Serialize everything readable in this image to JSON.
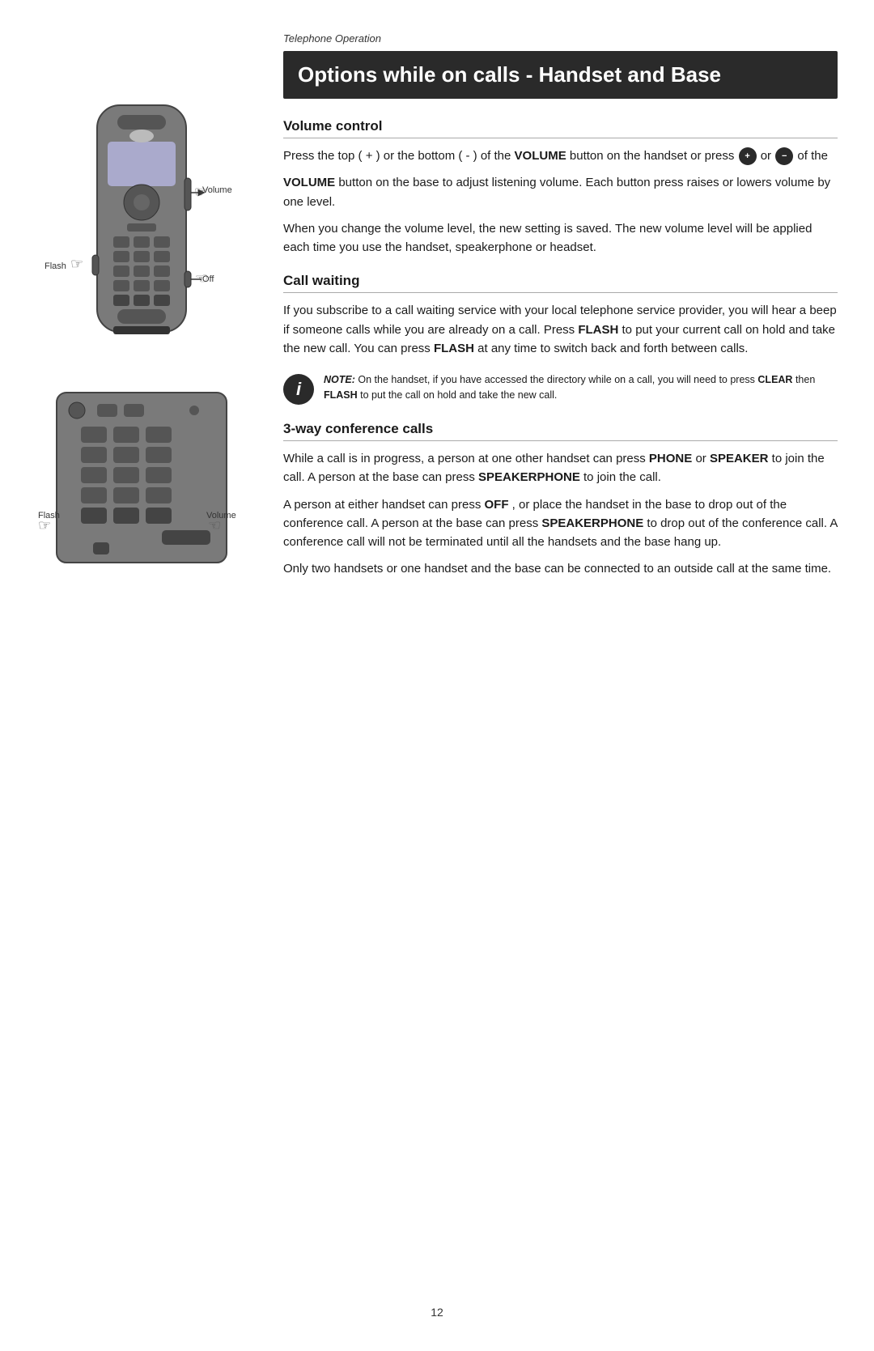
{
  "breadcrumb": "Telephone Operation",
  "page_title": "Options while on calls - Handset and Base",
  "page_number": "12",
  "sections": {
    "volume_control": {
      "title": "Volume control",
      "para1_start": "Press the top ( + ) or the bottom ( - ) of the ",
      "para1_bold1": "VOLUME",
      "para1_mid": " button on the handset or press",
      "para1_or": "or",
      "para1_end": " of the",
      "para2_bold": "VOLUME",
      "para2_end": " button on the base to adjust listening volume. Each button press raises or lowers volume by one level.",
      "para3": "When you change the volume level, the new setting is saved. The new volume level will be applied each time you use the handset, speakerphone or headset."
    },
    "call_waiting": {
      "title": "Call waiting",
      "para1_start": "If you subscribe to a call waiting service with your local telephone service provider, you will hear a beep if someone calls while you are already on a call. Press ",
      "para1_bold": "FLASH",
      "para1_end": " to put your current call on hold and take the new call. You can press ",
      "para1_bold2": "FLASH",
      "para1_end2": " at any time to switch back and forth between calls."
    },
    "note": {
      "label": "NOTE:",
      "text": " On the handset, if you have accessed the directory while on a call, you will need to press ",
      "bold1": "CLEAR",
      "text2": " then ",
      "bold2": "FLASH",
      "text3": " to put the call on hold and take the new call."
    },
    "conference": {
      "title": "3-way conference calls",
      "para1_start": "While a call is in progress, a person at one other handset can press ",
      "para1_bold1": "PHONE",
      "para1_or": " or ",
      "para1_bold2": "SPEAKER",
      "para1_end": " to join the call. A person at the base can press ",
      "para1_bold3": "SPEAKERPHONE",
      "para1_end2": " to join the call.",
      "para2_start": "A person at either handset can press ",
      "para2_bold1": "OFF",
      "para2_end1": ", or place the handset in the base to drop out of the conference call. A person at the base can press ",
      "para2_bold2": "SPEAKERPHONE",
      "para2_end2": " to drop out of the conference call. A conference call will not be terminated until all the handsets and the base hang up.",
      "para3": "Only two handsets or one handset and the base can be connected to an outside call at the same time."
    }
  },
  "labels": {
    "volume_handset": "Volume",
    "flash_handset": "Flash",
    "off_handset": "Off",
    "flash_base": "Flash",
    "volume_base": "Volume"
  },
  "vol_up_icon": "+",
  "vol_down_icon": "−"
}
